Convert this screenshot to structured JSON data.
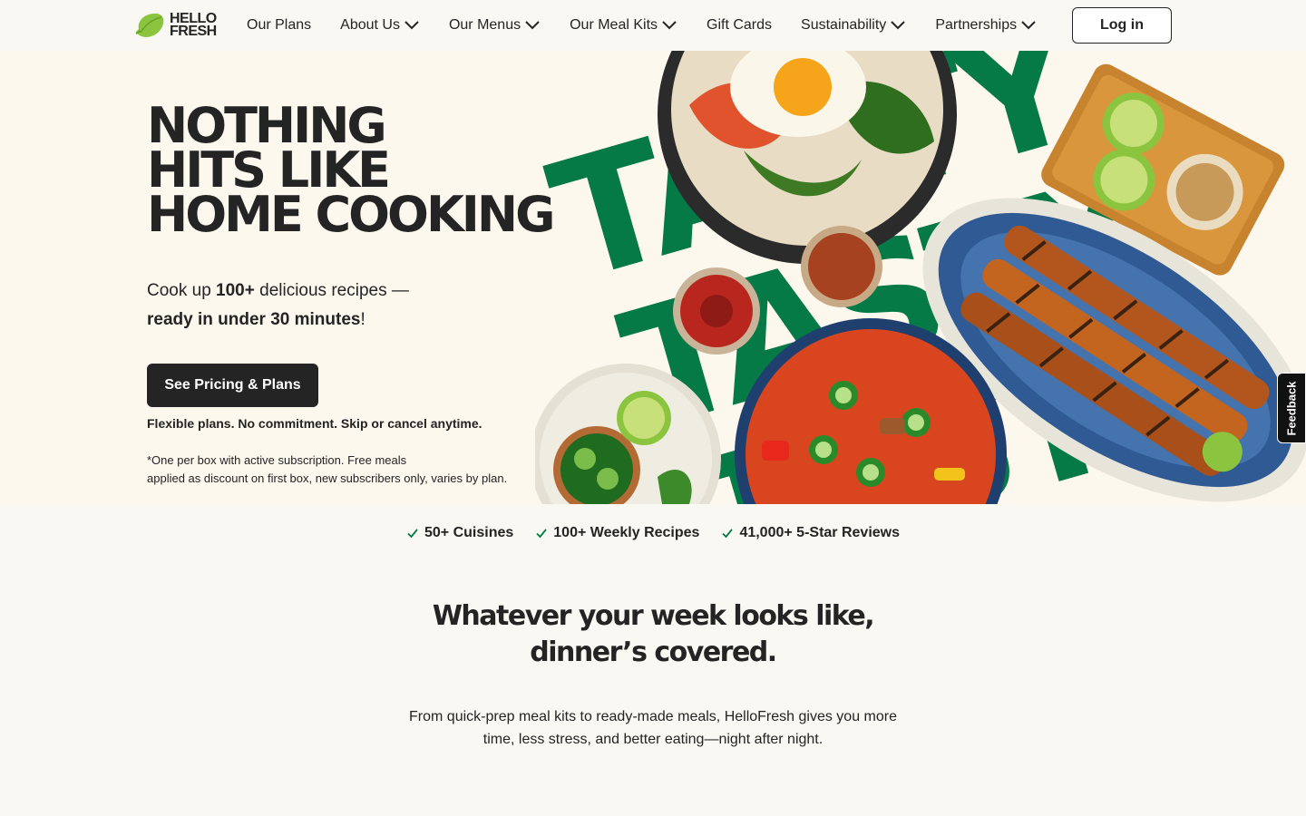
{
  "nav": {
    "logo_line1": "HELLO",
    "logo_line2": "FRESH",
    "items": [
      {
        "label": "Our Plans",
        "dropdown": false
      },
      {
        "label": "About Us",
        "dropdown": true
      },
      {
        "label": "Our Menus",
        "dropdown": true
      },
      {
        "label": "Our Meal Kits",
        "dropdown": true
      },
      {
        "label": "Gift Cards",
        "dropdown": false
      },
      {
        "label": "Sustainability",
        "dropdown": true
      },
      {
        "label": "Partnerships",
        "dropdown": true
      }
    ],
    "login_label": "Log in"
  },
  "hero": {
    "title_lines": [
      "NOTHING",
      "HITS LIKE",
      "HOME COOKING"
    ],
    "sub_1": "Cook up ",
    "sub_bold_1": "100+",
    "sub_2": " delicious recipes —",
    "sub_bold_2": "ready in under 30 minutes",
    "sub_3": "!",
    "cta_label": "See Pricing & Plans",
    "flex_note": "Flexible plans. No commitment. Skip or cancel anytime.",
    "disclaimer_line1": "*One per box with active subscription. Free meals",
    "disclaimer_line2": "applied as discount on first box, new subscribers only, varies by plan.",
    "background_word": "TASTY"
  },
  "feedback_label": "Feedback",
  "stats": [
    {
      "label": "50+ Cuisines"
    },
    {
      "label": "100+ Weekly Recipes"
    },
    {
      "label": "41,000+ 5-Star Reviews"
    }
  ],
  "week": {
    "title_line1": "Whatever your week looks like,",
    "title_line2": "dinner’s covered.",
    "description": "From quick-prep meal kits to ready-made meals, HelloFresh gives you more time, less stress, and better eating—night after night."
  },
  "colors": {
    "brand_green": "#067a46",
    "lime": "#8bc53f",
    "dark": "#242424",
    "hero_bg": "#fdf8ee",
    "page_bg": "#f9f8f2"
  }
}
